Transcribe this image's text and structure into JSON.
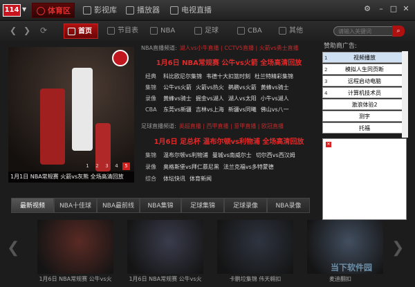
{
  "app": {
    "logo_text": "114",
    "top_tabs": [
      "体育区",
      "影视库",
      "播放器",
      "电视直播"
    ],
    "nav_tabs": [
      "首页",
      "节目表",
      "NBA",
      "足球",
      "CBA",
      "其他"
    ],
    "search_placeholder": "请输入关键词"
  },
  "feature": {
    "caption": "1月1日 NBA常规赛 火箭vs灰熊 全场高清回放",
    "pages": [
      "1",
      "2",
      "3",
      "4",
      "5"
    ],
    "active_page": "5"
  },
  "nba_channel": {
    "head_label": "NBA直播频道:",
    "head_links": "湖人vs小牛直播 | CCTV5直播 | 火箭vs勇士直播",
    "headline": "1月6日 NBA常规赛 公牛vs火箭 全场高清回放",
    "rows": [
      {
        "label": "经典",
        "items": [
          "科比欧尼尔集锦",
          "韦德十大扣篮时刻",
          "杜兰特精彩集锦"
        ]
      },
      {
        "label": "集锦",
        "items": [
          "公牛vs火箭",
          "火箭vs热火",
          "鹈鹕vs火箭",
          "黄蜂vs骑士"
        ]
      },
      {
        "label": "录像",
        "items": [
          "黄蜂vs骑士",
          "掘金vs湖人",
          "湖人vs太阳",
          "小牛vs湖人"
        ]
      },
      {
        "label": "CBA",
        "items": [
          "东莞vs新疆",
          "吉林vs上海",
          "新疆vs同曦",
          "佛山vs八一"
        ]
      }
    ]
  },
  "soccer_channel": {
    "head_label": "足球直播频道:",
    "head_links": "英超直播 | 西甲直播 | 意甲直播 | 欧冠直播",
    "headline": "1月6日 足总杯 温布尔顿vs利物浦 全场高清回放",
    "rows": [
      {
        "label": "集锦",
        "items": [
          "温布尔顿vs利物浦",
          "曼城vs南威尔士",
          "切尔西vs西汉姆"
        ]
      },
      {
        "label": "录像",
        "items": [
          "奥格斯堡vs拜仁慕尼黑",
          "法兰克福vs多特蒙德"
        ]
      },
      {
        "label": "综合",
        "items": [
          "体坛快讯",
          "体育新闻"
        ]
      }
    ]
  },
  "sponsor": {
    "title": "赞助商广告:",
    "items": [
      "视频播放",
      "模拟人生同页断",
      "远程启动电脑",
      "计算机技术员",
      "激浪体验2",
      "测字",
      "托福"
    ],
    "numbers": [
      "1",
      "2",
      "3",
      "4"
    ]
  },
  "categories": [
    "最新视频",
    "NBA十佳球",
    "NBA最前线",
    "NBA集锦",
    "足球集锦",
    "足球录像",
    "NBA录像"
  ],
  "thumbnails": [
    {
      "caption": "1月6日 NBA常规赛 公牛vs火",
      "bg": "#5a2a24"
    },
    {
      "caption": "1月6日 NBA常规赛 公牛vs火",
      "bg": "#3a3c4c"
    },
    {
      "caption": "卡鹏垃集锦 伟天翱扣",
      "bg": "#2e3440"
    },
    {
      "caption": "麦迪翻扣",
      "bg": "#424e60"
    }
  ],
  "watermark": "当下软件园",
  "colors": {
    "accent": "#d02020",
    "background": "#1c1c1c"
  }
}
